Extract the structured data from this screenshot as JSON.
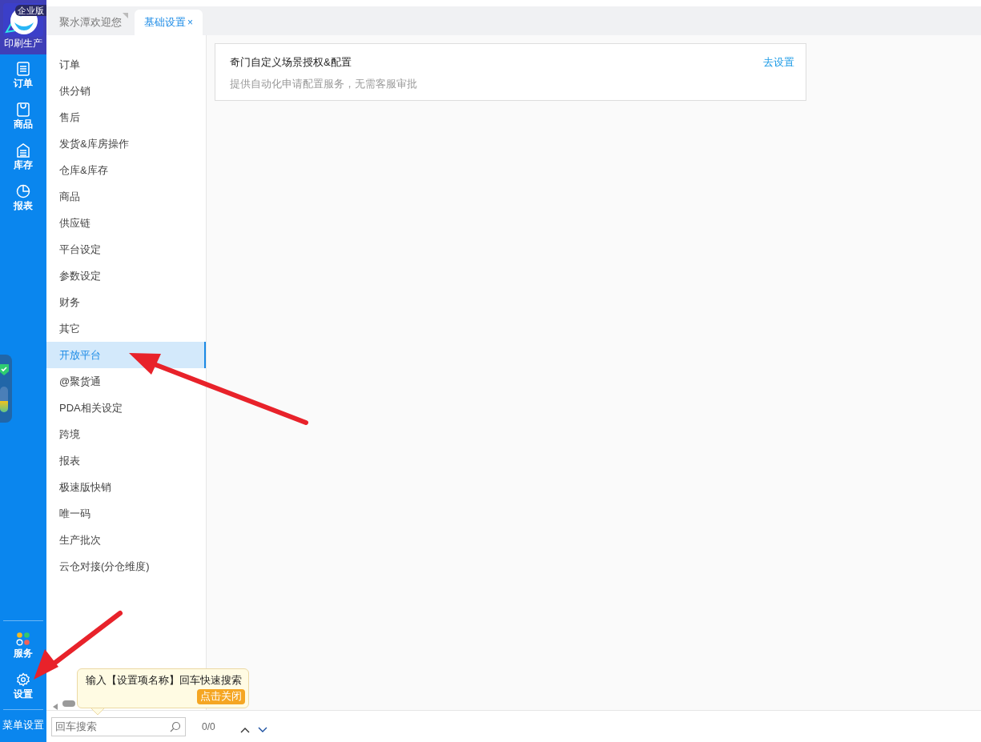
{
  "app_logo": {
    "badge": "企业版",
    "label": "印刷生产"
  },
  "rail_nav": [
    {
      "kind": "doc",
      "label": "订单"
    },
    {
      "kind": "bag",
      "label": "商品"
    },
    {
      "kind": "store",
      "label": "库存"
    },
    {
      "kind": "pie",
      "label": "报表"
    }
  ],
  "rail_bottom": [
    {
      "kind": "apps",
      "label": "服务"
    },
    {
      "kind": "gear",
      "label": "设置"
    }
  ],
  "menu_settings": "菜单设置",
  "floating_widget": {
    "level": 0.45
  },
  "tabs": [
    {
      "label": "聚水潭欢迎您",
      "selected": false
    },
    {
      "label": "基础设置",
      "selected": true,
      "close": "×"
    }
  ],
  "categories": [
    {
      "label": "订单",
      "selected": false
    },
    {
      "label": "供分销",
      "selected": false
    },
    {
      "label": "售后",
      "selected": false
    },
    {
      "label": "发货&库房操作",
      "selected": false
    },
    {
      "label": "仓库&库存",
      "selected": false
    },
    {
      "label": "商品",
      "selected": false
    },
    {
      "label": "供应链",
      "selected": false
    },
    {
      "label": "平台设定",
      "selected": false
    },
    {
      "label": "参数设定",
      "selected": false
    },
    {
      "label": "财务",
      "selected": false
    },
    {
      "label": "其它",
      "selected": false
    },
    {
      "label": "开放平台",
      "selected": true
    },
    {
      "label": "@聚货通",
      "selected": false
    },
    {
      "label": "PDA相关设定",
      "selected": false
    },
    {
      "label": "跨境",
      "selected": false
    },
    {
      "label": "报表",
      "selected": false
    },
    {
      "label": "极速版快销",
      "selected": false
    },
    {
      "label": "唯一码",
      "selected": false
    },
    {
      "label": "生产批次",
      "selected": false
    },
    {
      "label": "云仓对接(分仓维度)",
      "selected": false
    }
  ],
  "settings_cards": [
    {
      "title": "奇门自定义场景授权&配置",
      "description": "提供自动化申请配置服务，无需客服审批",
      "action": "去设置"
    }
  ],
  "search": {
    "placeholder": "回车搜索",
    "counter": "0/0",
    "tooltip": "输入【设置项名称】回车快速搜索",
    "tooltip_close": "点击关闭"
  }
}
